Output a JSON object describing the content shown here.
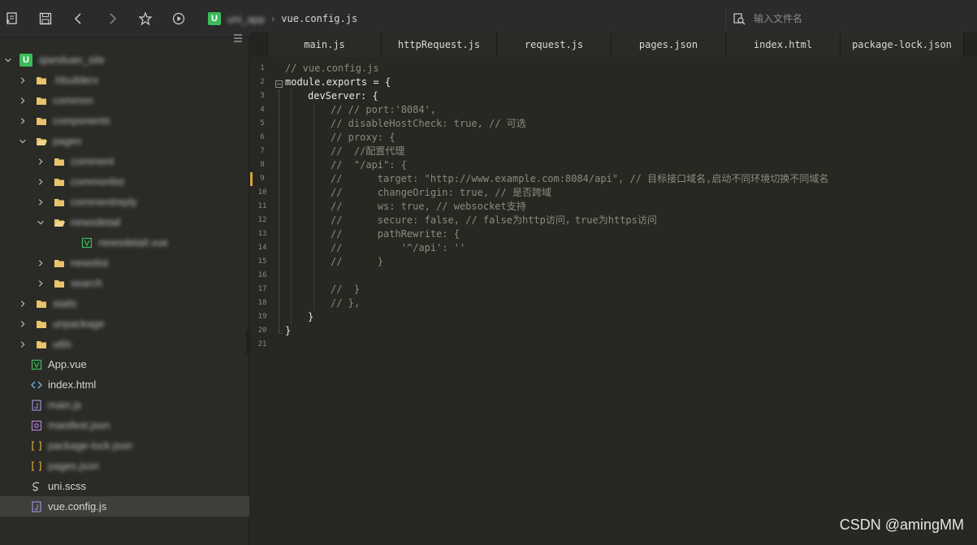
{
  "toolbar": {
    "project_crumb": "uni_app",
    "file_crumb": "vue.config.js",
    "search_placeholder": "输入文件名"
  },
  "sidebar": {
    "project_name": "qianduan_site",
    "items": [
      {
        "label": ".hbuilderx",
        "type": "folder",
        "depth": 1,
        "open": false,
        "blurred": true
      },
      {
        "label": "common",
        "type": "folder",
        "depth": 1,
        "open": false,
        "blurred": true
      },
      {
        "label": "components",
        "type": "folder",
        "depth": 1,
        "open": false,
        "blurred": true
      },
      {
        "label": "pages",
        "type": "folder",
        "depth": 1,
        "open": true,
        "blurred": true
      },
      {
        "label": "comment",
        "type": "folder",
        "depth": 2,
        "open": false,
        "blurred": true
      },
      {
        "label": "commonlist",
        "type": "folder",
        "depth": 2,
        "open": false,
        "blurred": true
      },
      {
        "label": "commentreply",
        "type": "folder",
        "depth": 2,
        "open": false,
        "blurred": true
      },
      {
        "label": "newsdetail",
        "type": "folder",
        "depth": 2,
        "open": true,
        "blurred": true
      },
      {
        "label": "newsdetail.vue",
        "type": "vue",
        "depth": 3,
        "open": false,
        "blurred": true
      },
      {
        "label": "newslist",
        "type": "folder",
        "depth": 2,
        "open": false,
        "blurred": true
      },
      {
        "label": "search",
        "type": "folder",
        "depth": 2,
        "open": false,
        "blurred": true
      },
      {
        "label": "static",
        "type": "folder",
        "depth": 1,
        "open": false,
        "blurred": true
      },
      {
        "label": "unpackage",
        "type": "folder",
        "depth": 1,
        "open": false,
        "blurred": true
      },
      {
        "label": "utils",
        "type": "folder",
        "depth": 1,
        "open": false,
        "blurred": true
      },
      {
        "label": "App.vue",
        "type": "vue",
        "depth": 1,
        "open": false,
        "blurred": false
      },
      {
        "label": "index.html",
        "type": "html",
        "depth": 1,
        "open": false,
        "blurred": false
      },
      {
        "label": "main.js",
        "type": "js",
        "depth": 1,
        "open": false,
        "blurred": true
      },
      {
        "label": "manifest.json",
        "type": "manifest",
        "depth": 1,
        "open": false,
        "blurred": true
      },
      {
        "label": "package-lock.json",
        "type": "json",
        "depth": 1,
        "open": false,
        "blurred": true
      },
      {
        "label": "pages.json",
        "type": "json",
        "depth": 1,
        "open": false,
        "blurred": true
      },
      {
        "label": "uni.scss",
        "type": "scss",
        "depth": 1,
        "open": false,
        "blurred": false
      },
      {
        "label": "vue.config.js",
        "type": "js",
        "depth": 1,
        "open": false,
        "blurred": false,
        "active": true
      }
    ]
  },
  "tabs": [
    "main.js",
    "httpRequest.js",
    "request.js",
    "pages.json",
    "index.html",
    "package-lock.json"
  ],
  "editor": {
    "lines": [
      {
        "n": "1",
        "text": "// vue.config.js",
        "comment": true,
        "indent": 0
      },
      {
        "n": "2",
        "text": "module.exports = {",
        "comment": false,
        "indent": 0,
        "fold": true
      },
      {
        "n": "3",
        "text": "devServer: {",
        "comment": false,
        "indent": 1
      },
      {
        "n": "4",
        "text": "// // port:'8084',",
        "comment": true,
        "indent": 2
      },
      {
        "n": "5",
        "text": "// disableHostCheck: true, // 可选",
        "comment": true,
        "indent": 2
      },
      {
        "n": "6",
        "text": "// proxy: {",
        "comment": true,
        "indent": 2
      },
      {
        "n": "7",
        "text": "//  //配置代理",
        "comment": true,
        "indent": 2
      },
      {
        "n": "8",
        "text": "//  \"/api\": {",
        "comment": true,
        "indent": 2
      },
      {
        "n": "9",
        "text": "//      target: \"http://www.example.com:8084/api\", // 目标接口域名,启动不同环境切换不同域名",
        "comment": true,
        "indent": 2,
        "modified": true
      },
      {
        "n": "10",
        "text": "//      changeOrigin: true, // 是否跨域",
        "comment": true,
        "indent": 2
      },
      {
        "n": "11",
        "text": "//      ws: true, // websocket支持",
        "comment": true,
        "indent": 2
      },
      {
        "n": "12",
        "text": "//      secure: false, // false为http访问，true为https访问",
        "comment": true,
        "indent": 2
      },
      {
        "n": "13",
        "text": "//      pathRewrite: {",
        "comment": true,
        "indent": 2
      },
      {
        "n": "14",
        "text": "//          '^/api': ''",
        "comment": true,
        "indent": 2
      },
      {
        "n": "15",
        "text": "//      }",
        "comment": true,
        "indent": 2
      },
      {
        "n": "16",
        "text": "",
        "comment": false,
        "indent": 0
      },
      {
        "n": "17",
        "text": "//  }",
        "comment": true,
        "indent": 2
      },
      {
        "n": "18",
        "text": "// },",
        "comment": true,
        "indent": 2
      },
      {
        "n": "19",
        "text": "}",
        "comment": false,
        "indent": 1
      },
      {
        "n": "20",
        "text": "}",
        "comment": false,
        "indent": 0
      },
      {
        "n": "21",
        "text": "",
        "comment": false,
        "indent": 0
      }
    ]
  },
  "watermark": "CSDN @amingMM",
  "colors": {
    "folder": "#e8c36b",
    "vue": "#3dbb5a",
    "html": "#6fb3e0",
    "js": "#9b8fd8",
    "json": "#d6a13a",
    "modified_marker": "#d6a13a"
  }
}
